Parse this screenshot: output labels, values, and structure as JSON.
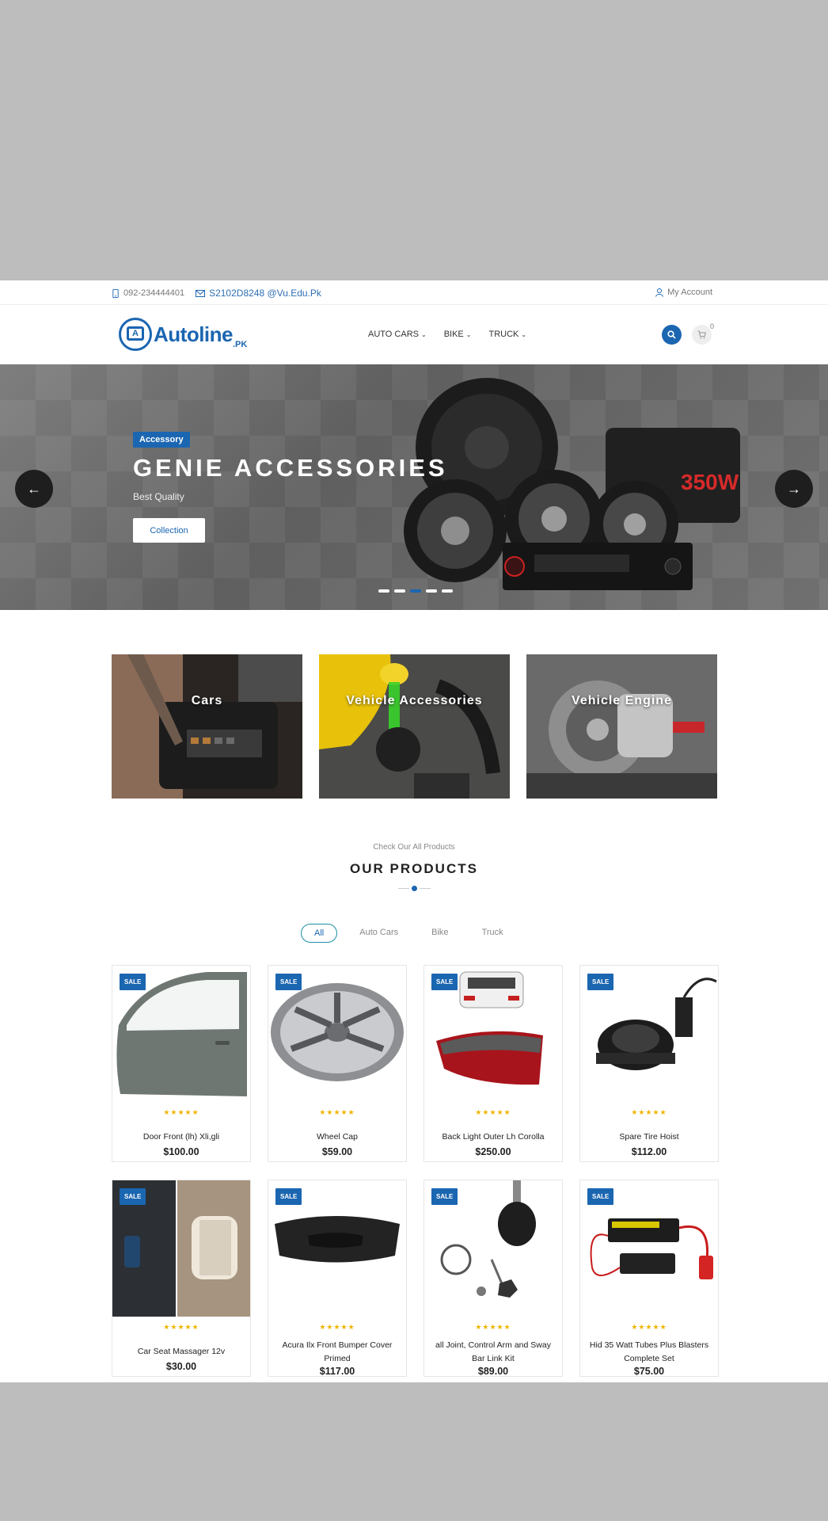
{
  "topbar": {
    "phone": "092-234444401",
    "email": "S2102D8248 @Vu.Edu.Pk",
    "account": "My Account"
  },
  "header": {
    "logo_name": "Autoline",
    "logo_tld": ".PK",
    "nav": [
      "AUTO CARS",
      "BIKE",
      "TRUCK"
    ],
    "cart_count": "0"
  },
  "hero": {
    "badge": "Accessory",
    "title": "GENIE ACCESSORIES",
    "subtitle": "Best Quality",
    "button": "Collection",
    "slides": 5,
    "active_slide": 3
  },
  "categories": [
    "Cars",
    "Vehicle Accessories",
    "Vehicle Engine"
  ],
  "products_section": {
    "pre_title": "Check Our All Products",
    "title": "OUR PRODUCTS",
    "filters": [
      "All",
      "Auto Cars",
      "Bike",
      "Truck"
    ],
    "active_filter": "All"
  },
  "products": [
    {
      "name": "Door Front (lh) Xli,gli",
      "price": "$100.00",
      "sale": "SALE",
      "stars": "★★★★★",
      "image": "car-door"
    },
    {
      "name": "Wheel Cap",
      "price": "$59.00",
      "sale": "SALE",
      "stars": "★★★★★",
      "image": "wheel-cap"
    },
    {
      "name": "Back Light Outer Lh Corolla",
      "price": "$250.00",
      "sale": "SALE",
      "stars": "★★★★★",
      "image": "tail-light"
    },
    {
      "name": "Spare Tire Hoist",
      "price": "$112.00",
      "sale": "SALE",
      "stars": "★★★★★",
      "image": "tire-hoist"
    },
    {
      "name": "Car Seat Massager 12v",
      "price": "$30.00",
      "sale": "SALE",
      "stars": "★★★★★",
      "image": "seat-massager"
    },
    {
      "name": "Acura Ilx Front Bumper Cover Primed",
      "price": "$117.00",
      "sale": "SALE",
      "stars": "★★★★★",
      "image": "bumper"
    },
    {
      "name": "all Joint, Control Arm and Sway Bar Link Kit",
      "price": "$89.00",
      "sale": "SALE",
      "stars": "★★★★★",
      "image": "ball-joint"
    },
    {
      "name": "Hid 35 Watt Tubes Plus Blasters Complete Set",
      "price": "$75.00",
      "sale": "SALE",
      "stars": "★★★★★",
      "image": "hid-kit"
    }
  ],
  "colors": {
    "brand": "#1b66b1",
    "star": "#f0b400"
  }
}
